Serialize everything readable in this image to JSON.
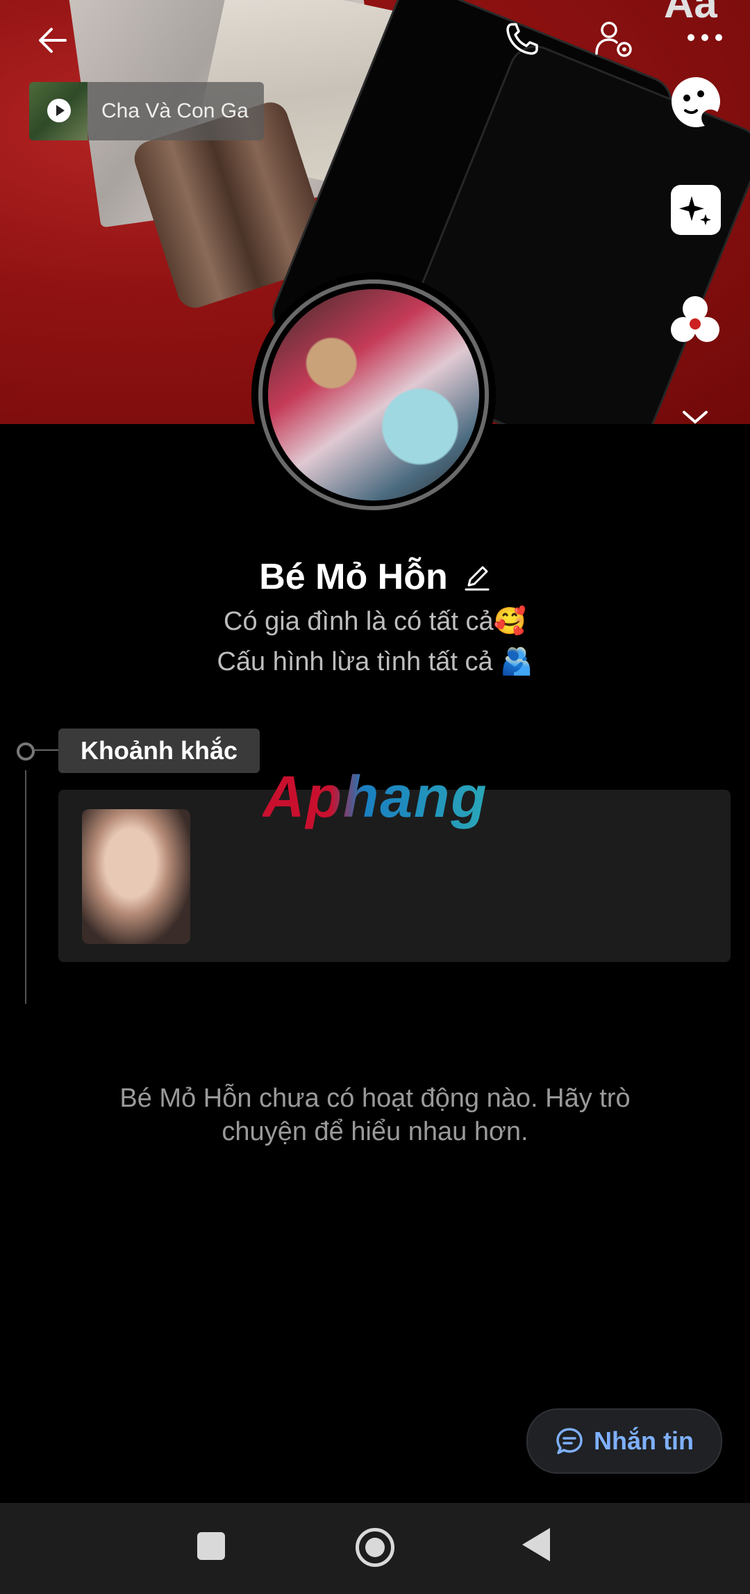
{
  "header": {
    "music_title": "Cha Và Con Ga",
    "corner_text": "Aa"
  },
  "profile": {
    "name": "Bé Mỏ Hỗn",
    "bio_line1": "Có gia đình là có tất cả🥰",
    "bio_line2": "Cấu hình lừa tình tất cả 🫂"
  },
  "timeline": {
    "moments_label": "Khoảnh khắc",
    "watermark": "Aphang"
  },
  "empty_state": {
    "message": "Bé Mỏ Hỗn chưa có hoạt động nào. Hãy trò chuyện để hiểu nhau hơn."
  },
  "actions": {
    "message_button": "Nhắn tin"
  },
  "colors": {
    "accent": "#7fb0ff",
    "background": "#000000"
  }
}
